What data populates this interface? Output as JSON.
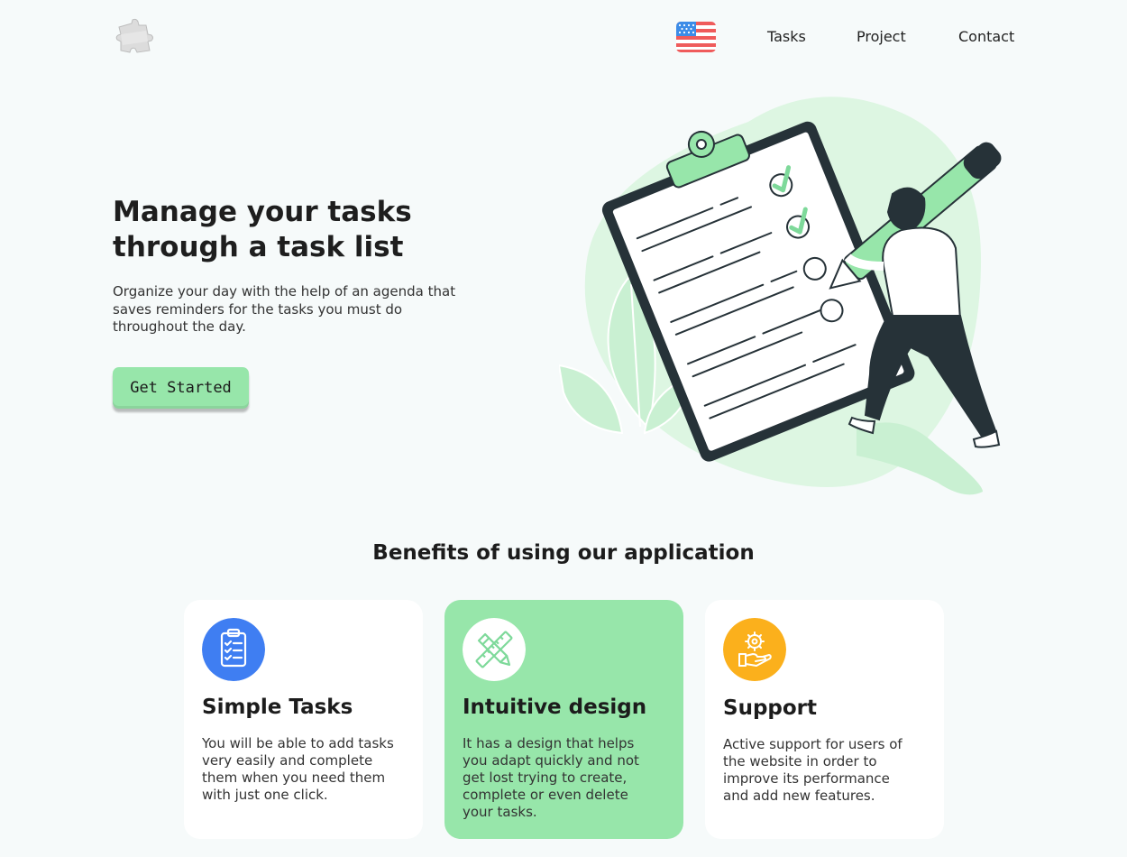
{
  "nav": {
    "logo_icon": "puzzle-piece-icon",
    "language_flag_icon": "us-flag-icon",
    "links": [
      "Tasks",
      "Project",
      "Contact"
    ]
  },
  "hero": {
    "title_line1": "Manage your tasks",
    "title_line2": "through a task list",
    "description": "Organize your day with the help of an agenda that saves reminders for the tasks you must do throughout the day.",
    "cta_label": "Get Started",
    "illustration_icon": "clipboard-checklist-illustration"
  },
  "benefits": {
    "title": "Benefits of using our application",
    "cards": [
      {
        "title": "Simple Tasks",
        "text": "You will be able to add tasks very easily and complete them when you need them with just one click.",
        "icon": "clipboard-checklist-icon",
        "icon_bg": "#3f7ef2"
      },
      {
        "title": "Intuitive design",
        "text": "It has a design that helps you adapt quickly and not get lost trying to create, complete or even delete your tasks.",
        "icon": "pencil-ruler-icon",
        "icon_bg": "#ffffff"
      },
      {
        "title": "Support",
        "text": "Active support for users of the website in order to improve its performance and add new features.",
        "icon": "support-hand-gear-icon",
        "icon_bg": "#fbb01c"
      }
    ]
  },
  "colors": {
    "accent_green": "#97e6aa",
    "page_bg": "#f6fafa",
    "dark": "#263238"
  }
}
